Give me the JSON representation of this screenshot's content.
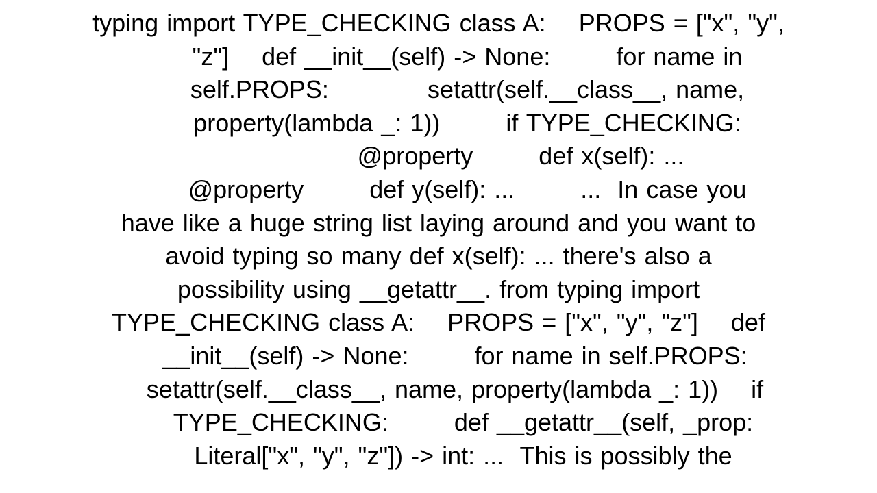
{
  "content": {
    "text": "typing import TYPE_CHECKING class A:    PROPS = [\"x\", \"y\", \"z\"]    def __init__(self) -> None:        for name in self.PROPS:            setattr(self.__class__, name, property(lambda _: 1))        if TYPE_CHECKING:                @property        def x(self): ...        @property        def y(self): ...        ...  In case you have like a huge string list laying around and you want to avoid typing so many def x(self): ... there's also a possibility using __getattr__. from typing import TYPE_CHECKING class A:    PROPS = [\"x\", \"y\", \"z\"]    def __init__(self) -> None:        for name in self.PROPS:        setattr(self.__class__, name, property(lambda _: 1))    if TYPE_CHECKING:        def __getattr__(self, _prop: Literal[\"x\", \"y\", \"z\"]) -> int: ...  This is possibly the"
  }
}
